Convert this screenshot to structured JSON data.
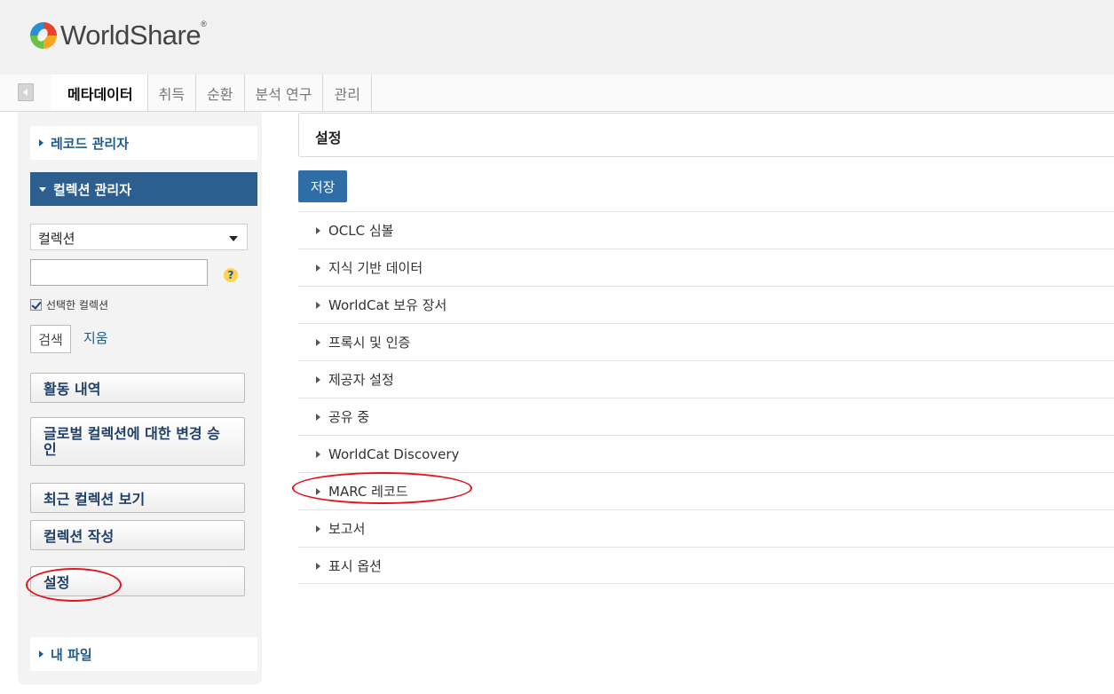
{
  "app": {
    "logo_text": "WorldShare"
  },
  "nav": {
    "tabs": [
      {
        "label": "메타데이터"
      },
      {
        "label": "취득"
      },
      {
        "label": "순환"
      },
      {
        "label": "분석 연구"
      },
      {
        "label": "관리"
      }
    ]
  },
  "sidebar": {
    "record_manager": "레코드 관리자",
    "collection_manager": "컬렉션 관리자",
    "select_value": "컬렉션",
    "search_value": "",
    "help_label": "?",
    "checkbox_label": "선택한 컬렉션",
    "checkbox_checked": true,
    "search_button": "검색",
    "clear_link": "지움",
    "buttons": [
      {
        "label": "활동 내역"
      },
      {
        "label": "글로벌 컬렉션에 대한 변경 승인"
      },
      {
        "label": "최근 컬렉션 보기"
      },
      {
        "label": "컬렉션 작성"
      },
      {
        "label": "설정"
      }
    ],
    "my_files": "내 파일"
  },
  "main": {
    "title": "설정",
    "save_button": "저장",
    "sections": [
      {
        "label": "OCLC 심볼"
      },
      {
        "label": "지식 기반 데이터"
      },
      {
        "label": "WorldCat 보유 장서"
      },
      {
        "label": "프록시 및 인증"
      },
      {
        "label": "제공자 설정"
      },
      {
        "label": "공유 중"
      },
      {
        "label": "WorldCat Discovery"
      },
      {
        "label": "MARC 레코드"
      },
      {
        "label": "보고서"
      },
      {
        "label": "표시 옵션"
      }
    ]
  },
  "colors": {
    "accent": "#2c5f8f",
    "link": "#1f5a8c",
    "highlight_oval": "#e3141c",
    "save_button": "#2f6da6"
  }
}
